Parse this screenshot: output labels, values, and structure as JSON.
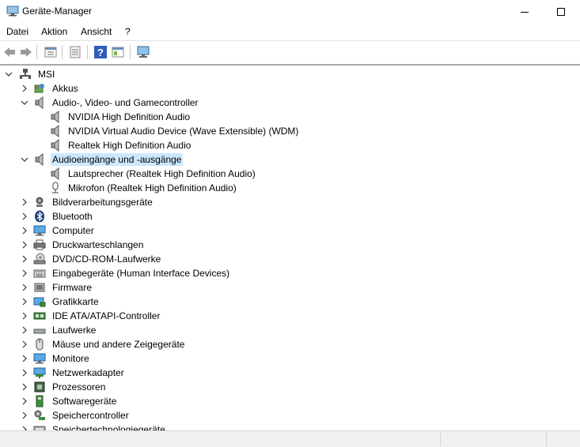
{
  "window": {
    "title": "Geräte-Manager"
  },
  "menu": [
    {
      "label": "Datei"
    },
    {
      "label": "Aktion"
    },
    {
      "label": "Ansicht"
    },
    {
      "label": "?"
    }
  ],
  "toolbar": {
    "icons": [
      "back-icon",
      "forward-icon",
      "properties-icon",
      "update-driver-icon",
      "help-icon",
      "view-icon",
      "monitor-scan-icon"
    ]
  },
  "tree": {
    "root": {
      "label": "MSI",
      "expanded": true
    },
    "categories": [
      {
        "label": "Akkus",
        "icon": "battery-icon",
        "expanded": false
      },
      {
        "label": "Audio-, Video- und Gamecontroller",
        "icon": "speaker-icon",
        "expanded": true,
        "children": [
          {
            "label": "NVIDIA High Definition Audio",
            "icon": "speaker-icon"
          },
          {
            "label": "NVIDIA Virtual Audio Device (Wave Extensible) (WDM)",
            "icon": "speaker-icon"
          },
          {
            "label": "Realtek High Definition Audio",
            "icon": "speaker-icon"
          }
        ]
      },
      {
        "label": "Audioeingänge und -ausgänge",
        "icon": "speaker-icon",
        "expanded": true,
        "selected": true,
        "children": [
          {
            "label": "Lautsprecher (Realtek High Definition Audio)",
            "icon": "speaker-icon"
          },
          {
            "label": "Mikrofon (Realtek High Definition Audio)",
            "icon": "microphone-icon"
          }
        ]
      },
      {
        "label": "Bildverarbeitungsgeräte",
        "icon": "camera-icon",
        "expanded": false
      },
      {
        "label": "Bluetooth",
        "icon": "bluetooth-icon",
        "expanded": false
      },
      {
        "label": "Computer",
        "icon": "computer-icon",
        "expanded": false
      },
      {
        "label": "Druckwarteschlangen",
        "icon": "printer-icon",
        "expanded": false
      },
      {
        "label": "DVD/CD-ROM-Laufwerke",
        "icon": "disc-drive-icon",
        "expanded": false
      },
      {
        "label": "Eingabegeräte (Human Interface Devices)",
        "icon": "keyboard-icon",
        "expanded": false
      },
      {
        "label": "Firmware",
        "icon": "firmware-icon",
        "expanded": false
      },
      {
        "label": "Grafikkarte",
        "icon": "graphics-card-icon",
        "expanded": false
      },
      {
        "label": "IDE ATA/ATAPI-Controller",
        "icon": "ide-controller-icon",
        "expanded": false
      },
      {
        "label": "Laufwerke",
        "icon": "drive-icon",
        "expanded": false
      },
      {
        "label": "Mäuse und andere Zeigegeräte",
        "icon": "mouse-icon",
        "expanded": false
      },
      {
        "label": "Monitore",
        "icon": "monitor-icon",
        "expanded": false
      },
      {
        "label": "Netzwerkadapter",
        "icon": "network-adapter-icon",
        "expanded": false
      },
      {
        "label": "Prozessoren",
        "icon": "processor-icon",
        "expanded": false
      },
      {
        "label": "Softwaregeräte",
        "icon": "software-device-icon",
        "expanded": false
      },
      {
        "label": "Speichercontroller",
        "icon": "storage-controller-icon",
        "expanded": false
      },
      {
        "label": "Speichertechnologiegeräte",
        "icon": "storage-technology-icon",
        "expanded": false
      }
    ]
  }
}
